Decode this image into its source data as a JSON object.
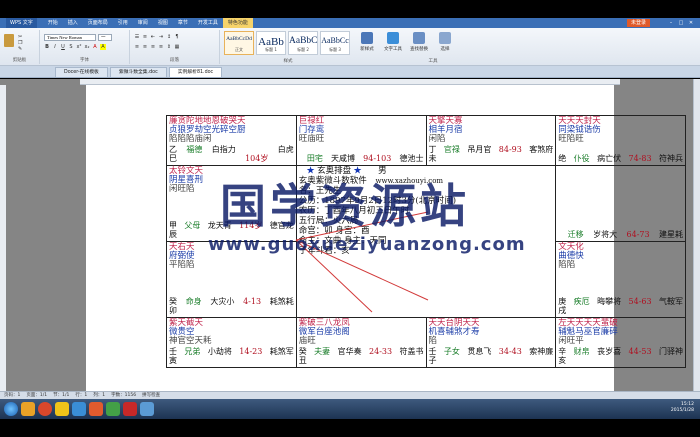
{
  "app": {
    "name": "WPS 文字",
    "menu": [
      "开始",
      "插入",
      "页面布局",
      "引用",
      "审阅",
      "视图",
      "章节",
      "开发工具",
      "特色功能"
    ],
    "active_menu": 8,
    "login": "未登录"
  },
  "ribbon": {
    "font_name": "Times New Roman",
    "font_size": "一",
    "clipboard_label": "剪贴板",
    "font_label": "字体",
    "paragraph_label": "段落",
    "styles_label": "样式",
    "tools_label": "工具",
    "styles": [
      {
        "sample": "AaBbCcDd",
        "label": "正文"
      },
      {
        "sample": "AaBb",
        "label": "标题 1"
      },
      {
        "sample": "AaBbC",
        "label": "标题 2"
      },
      {
        "sample": "AaBbCc",
        "label": "标题 3"
      }
    ],
    "new_style": "新样式",
    "text_tools": "文字工具",
    "find_replace": "查找替换",
    "select": "选择"
  },
  "tabs": [
    {
      "label": "Docer-在线模板"
    },
    {
      "label": "紫微斗数全集.doc"
    },
    {
      "label": "实例解析81.doc"
    }
  ],
  "active_tab": 2,
  "chart": {
    "cells": {
      "c00": {
        "stars": "廉贪陀地地恩破哭天",
        "stars2": "贞狼罗劫空光碎空厨",
        "attr": "陷陷陷庙闲",
        "foot": [
          "乙\n巳",
          "福德",
          "白指力",
          "\n104岁",
          "白虎"
        ]
      },
      "c01": {
        "stars": "巨禄红",
        "stars2": "门存鸾",
        "attr": "旺庙旺",
        "foot": [
          "",
          "田宅",
          "天咸博",
          "94-103",
          "德池士"
        ]
      },
      "c02": {
        "stars": "天擎天寡",
        "stars2": "相羊月宿",
        "attr": "闲陷",
        "foot": [
          "丁\n未",
          "官禄",
          "吊月官",
          "84-93",
          "客煞府"
        ]
      },
      "c03": {
        "stars": "天天天封天",
        "stars2": "同梁钺诰伤",
        "attr": "旺陷旺",
        "foot": [
          "绝",
          "仆役",
          "病亡伏",
          "74-83",
          "符神兵"
        ]
      },
      "c10": {
        "stars": "太铃文天",
        "stars2": "阴星喜刑",
        "attr": "闲旺陷",
        "foot": [
          "甲\n辰",
          "父母",
          "龙天青",
          "114岁",
          "德官龙"
        ]
      },
      "c13": {
        "stars": "",
        "stars2": "",
        "attr": "",
        "foot": [
          "",
          "迁移",
          "岁将大",
          "64-73",
          "建星耗"
        ]
      },
      "c20": {
        "stars": "天右天",
        "stars2": "府弼使",
        "attr": "平陷陷",
        "foot": [
          "癸\n卯",
          "命身",
          "大灾小",
          "4-13",
          "耗煞耗"
        ]
      },
      "c23": {
        "stars": "文天化",
        "stars2": "曲德快",
        "attr": "陷陷",
        "foot": [
          "庚\n戌",
          "疾厄",
          "晦攀将",
          "54-63",
          "气鞍军"
        ]
      },
      "c30": {
        "stars": "紫天截天",
        "stars2": "微贵空",
        "attr": "神官空天耗",
        "foot": [
          "壬\n寅",
          "兄弟",
          "小劫将",
          "14-23",
          "耗煞军"
        ]
      },
      "c31": {
        "stars": "紫破三八龙凤",
        "stars2": "微军台座池阁",
        "attr": "庙旺",
        "foot": [
          "癸\n丑",
          "夫妻",
          "官华奏",
          "24-33",
          "符盖书"
        ]
      },
      "c32": {
        "stars": "天天台阴天天",
        "stars2": "机喜辅煞才寿",
        "attr": "陷",
        "foot": [
          "壬\n子",
          "子女",
          "贯息飞",
          "34-43",
          "索神廉"
        ]
      },
      "c33": {
        "stars": "左天天天天蜚破",
        "stars2": "辅魁马巫官廉碎",
        "attr": "闲旺平",
        "foot": [
          "辛\n亥",
          "财帛",
          "丧岁喜",
          "44-53",
          "门驿神"
        ]
      }
    },
    "center": {
      "title_prefix": "★",
      "title": "玄奥排盘",
      "title_suffix": "★",
      "brand": "玄奥紫微斗数软件",
      "site": "www.xazhouyi.com",
      "gender": "男",
      "label_name": "名：王先生",
      "solar": "公历：1897年9月2日12时3分(北京时间)",
      "lunar": "农历：丁酉年八月初三日午时",
      "line4": "五行局：火六局",
      "line5": "命主：文曲 身主：天同",
      "line6": "命宫：卯   身宫：酉",
      "line7": "子年斗君：亥"
    }
  },
  "watermark": {
    "main": "国学资源站",
    "url": "www.guoxueziyuanzong.com"
  },
  "status": {
    "page": "页码：1",
    "pages": "页面：1/1",
    "section": "节：1/1",
    "row": "行：1",
    "col": "列：1",
    "words": "字数：1156",
    "spell": "拼写检查"
  },
  "tray": {
    "time": "15:12",
    "date": "2015/1/28"
  }
}
